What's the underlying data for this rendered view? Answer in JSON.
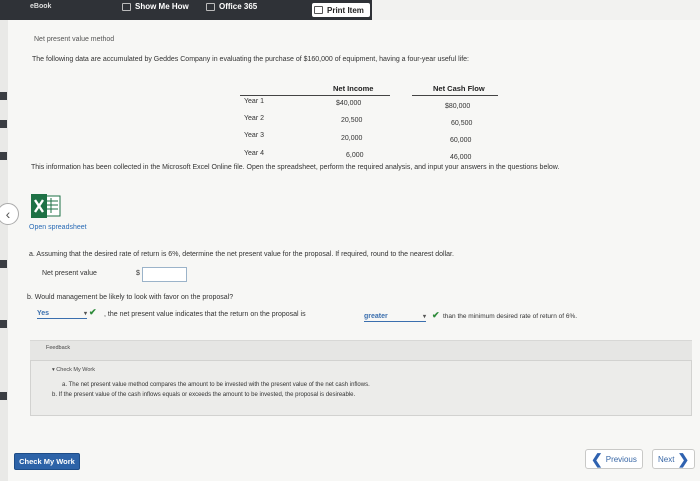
{
  "toolbar": {
    "ebook": "eBook",
    "show_me_how": "Show Me How",
    "office_365": "Office 365",
    "print_item": "Print Item"
  },
  "problem": {
    "section_title": "Net present value method",
    "intro": "The following data are accumulated by Geddes Company in evaluating the purchase of $160,000 of equipment, having a four-year useful life:",
    "table": {
      "headers": {
        "net_income": "Net Income",
        "net_cash_flow": "Net Cash Flow"
      },
      "rows": [
        {
          "year": "Year 1",
          "net_income": "$40,000",
          "net_cash_flow": "$80,000"
        },
        {
          "year": "Year 2",
          "net_income": "20,500",
          "net_cash_flow": "60,500"
        },
        {
          "year": "Year 3",
          "net_income": "20,000",
          "net_cash_flow": "60,000"
        },
        {
          "year": "Year 4",
          "net_income": "6,000",
          "net_cash_flow": "46,000"
        }
      ]
    },
    "note": "This information has been collected in the Microsoft Excel Online file. Open the spreadsheet, perform the required analysis, and input your answers in the questions below."
  },
  "open_spreadsheet": "Open spreadsheet",
  "question_a": {
    "text": "a. Assuming that the desired rate of return is 6%, determine the net present value for the proposal. If required, round to the nearest dollar.",
    "label": "Net present value",
    "currency": "$",
    "value": ""
  },
  "question_b": {
    "text": "b. Would management be likely to look with favor on the proposal?",
    "select1": "Yes",
    "middle": ", the net present value indicates that the return on the proposal is",
    "select2": "greater",
    "end": "than the minimum desired rate of return of 6%."
  },
  "feedback": {
    "label": "Feedback",
    "check_my_work": "Check My Work",
    "line_a": "a. The net present value method compares the amount to be invested with the present value of the net cash inflows.",
    "line_b": "b. If the present value of the cash inflows equals or exceeds the amount to be invested, the proposal is desireable."
  },
  "buttons": {
    "check_my_work": "Check My Work",
    "previous": "Previous",
    "next": "Next"
  },
  "colors": {
    "accent": "#2d63a8",
    "correct": "#2e8b3a",
    "excel": "#1e7145"
  }
}
